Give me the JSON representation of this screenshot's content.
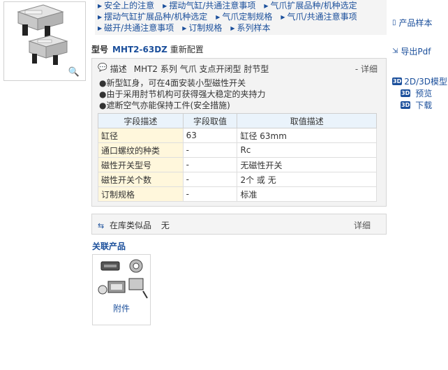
{
  "top_links": [
    [
      "安全上的注意",
      "摆动气缸/共通注意事项",
      "气爪扩展品种/机种选定"
    ],
    [
      "摆动气缸扩展品种/机种选定",
      "气爪定制规格",
      "气爪/共通注意事项"
    ],
    [
      "磁开/共通注意事项",
      "订制规格",
      "系列样本"
    ]
  ],
  "sidebar": {
    "catalog": "产品样本",
    "export_pdf": "导出Pdf",
    "model_2d3d": "2D/3D模型",
    "preview": "预览",
    "download": "下载",
    "badge": "3D"
  },
  "model": {
    "label": "型号",
    "number": "MHT2-63DZ",
    "reconfig": "重新配置"
  },
  "description": {
    "label": "描述",
    "text": "MHT2 系列 气爪 支点开闭型 肘节型",
    "more": "- 详细",
    "features": [
      "●新型缸身，可在4面安装小型磁性开关",
      "●由于采用肘节机构可获得强大稳定的夹持力",
      "●遮断空气亦能保持工件(安全措施)"
    ]
  },
  "spec_table": {
    "headers": [
      "字段描述",
      "字段取值",
      "取值描述"
    ],
    "rows": [
      [
        "缸径",
        "63",
        "缸径 63mm"
      ],
      [
        "通口螺纹的种类",
        "-",
        "Rc"
      ],
      [
        "磁性开关型号",
        "-",
        "无磁性开关"
      ],
      [
        "磁性开关个数",
        "-",
        "2个 或 无"
      ],
      [
        "订制规格",
        "-",
        "标准"
      ]
    ]
  },
  "stock": {
    "label": "在库类似品",
    "value": "无",
    "more": "详细"
  },
  "related": {
    "title": "关联产品",
    "item": "附件"
  }
}
